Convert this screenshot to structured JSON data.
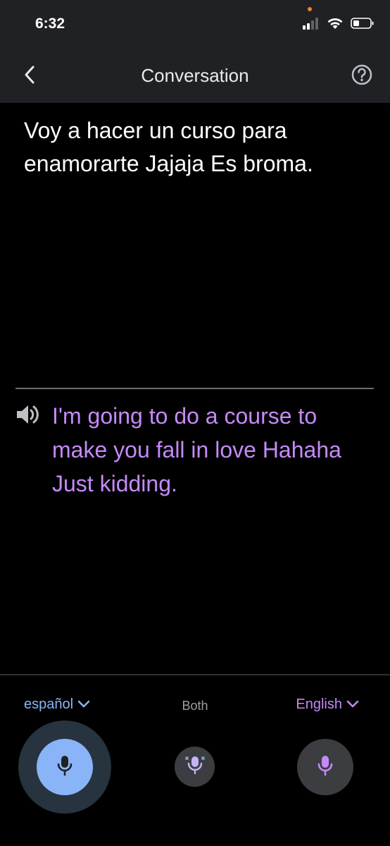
{
  "status_bar": {
    "time": "6:32",
    "signal_icon": "cellular-signal-icon",
    "wifi_icon": "wifi-icon",
    "battery_icon": "battery-icon",
    "indicator_color": "#e8852b"
  },
  "app_bar": {
    "title": "Conversation",
    "back_icon": "chevron-left-icon",
    "help_icon": "help-circle-icon"
  },
  "conversation": {
    "source_text": "Voy a hacer un curso para enamorarte Jajaja Es broma.",
    "translated_text": "I'm going to do a course to make you fall in love Hahaha Just kidding.",
    "speaker_icon": "speaker-icon"
  },
  "languages": {
    "left": "español",
    "both": "Both",
    "right": "English"
  },
  "mics": {
    "left_icon": "microphone-icon",
    "both_icon": "microphone-auto-icon",
    "right_icon": "microphone-icon"
  },
  "colors": {
    "background": "#000000",
    "app_bar": "#202124",
    "source_text": "#ffffff",
    "translated_text": "#c58af9",
    "left_accent": "#8ab4f8",
    "right_accent": "#c58af9"
  }
}
